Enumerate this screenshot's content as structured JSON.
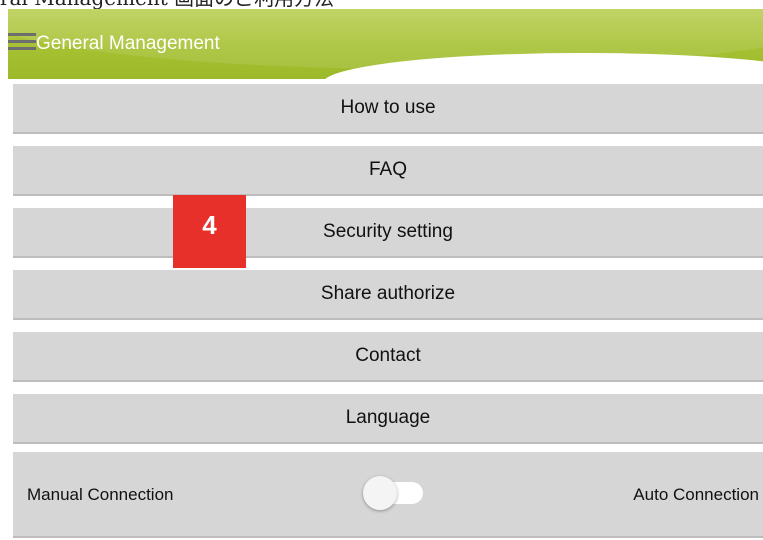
{
  "header": {
    "top_caption": "ral Management 画面のご利用方法",
    "title": "General Management",
    "menu_icon": "hamburger-menu-icon"
  },
  "menu": {
    "items": [
      {
        "label": "How to use"
      },
      {
        "label": "FAQ"
      },
      {
        "label": "Security setting"
      },
      {
        "label": "Share authorize"
      },
      {
        "label": "Contact"
      },
      {
        "label": "Language"
      }
    ]
  },
  "connection": {
    "left_label": "Manual Connection",
    "right_label": "Auto Connection",
    "toggle_state": "off"
  },
  "annotation": {
    "step_number": "4",
    "color": "#e8302b"
  },
  "colors": {
    "appbar": "#a6c132",
    "button_bg": "#d6d6d6",
    "title_text": "#ffffff"
  }
}
